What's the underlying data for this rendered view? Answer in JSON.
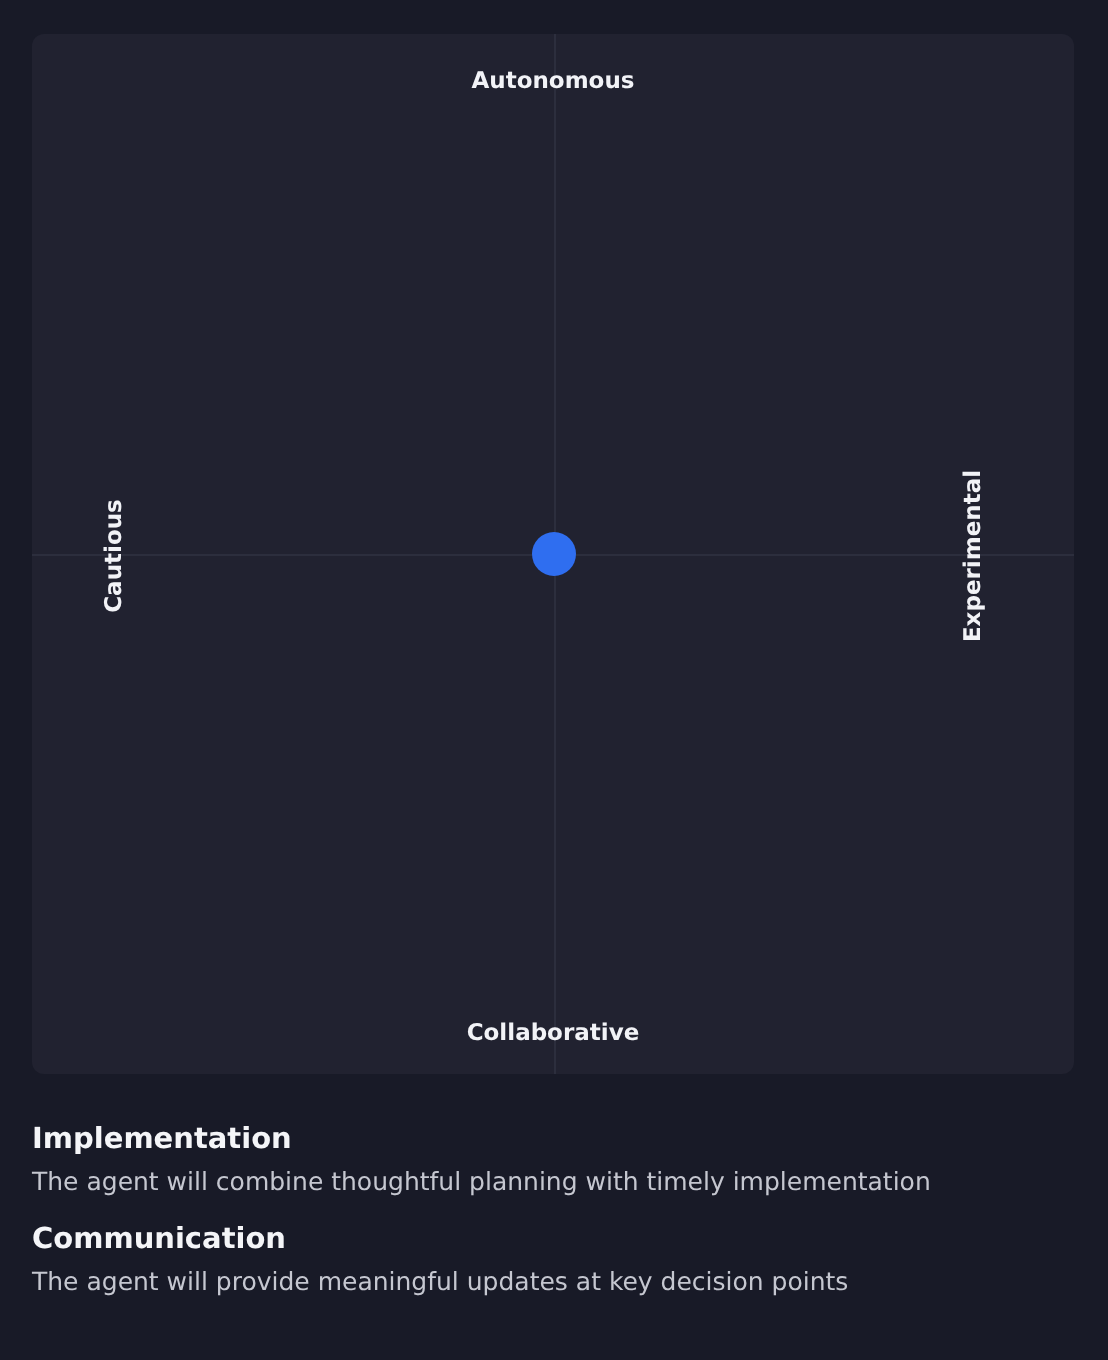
{
  "axes": {
    "top": "Autonomous",
    "left": "Cautious",
    "right": "Experimental",
    "bottom": "Collaborative"
  },
  "traits": [
    {
      "title": "Implementation",
      "description": "The agent will combine thoughtful planning with timely implementation"
    },
    {
      "title": "Communication",
      "description": "The agent will provide meaningful updates at key decision points"
    }
  ]
}
